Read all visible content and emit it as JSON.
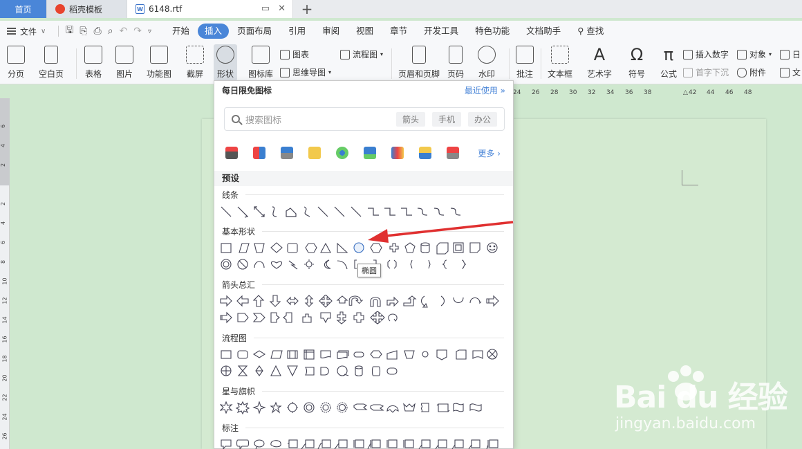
{
  "tabs": {
    "home": "首页",
    "template": "稻壳模板",
    "doc": "6148.rtf"
  },
  "menubar": {
    "file": "文件",
    "items": [
      "开始",
      "插入",
      "页面布局",
      "引用",
      "审阅",
      "视图",
      "章节",
      "开发工具",
      "特色功能",
      "文档助手",
      "查找"
    ],
    "active_index": 1
  },
  "ribbon": {
    "page_break": "分页",
    "blank_page": "空白页",
    "table": "表格",
    "picture": "图片",
    "function_chart": "功能图",
    "screenshot": "截屏",
    "shape": "形状",
    "icon_library": "图标库",
    "chart": "图表",
    "flowchart": "流程图",
    "mindmap": "思维导图",
    "header_footer": "页眉和页脚",
    "page_number": "页码",
    "watermark": "水印",
    "comment": "批注",
    "textbox": "文本框",
    "wordart": "艺术字",
    "symbol": "符号",
    "formula": "公式",
    "insert_number": "插入数字",
    "drop_cap": "首字下沉",
    "object": "对象",
    "attachment": "附件",
    "date_partial": "日",
    "doc_partial": "文"
  },
  "ruler": {
    "top": [
      "24",
      "26",
      "28",
      "30",
      "32",
      "34",
      "36",
      "38",
      "42",
      "44",
      "46",
      "48"
    ],
    "left": [
      "6",
      "4",
      "2",
      "2",
      "4",
      "6",
      "8",
      "10",
      "12",
      "14",
      "16",
      "18",
      "20",
      "22",
      "24",
      "26"
    ]
  },
  "panel": {
    "title": "每日限免图标",
    "recent": "最近使用",
    "search_placeholder": "搜索图标",
    "chips": [
      "箭头",
      "手机",
      "办公"
    ],
    "more": "更多",
    "preset": "预设",
    "categories": {
      "lines": "线条",
      "basic": "基本形状",
      "arrows": "箭头总汇",
      "flow": "流程图",
      "stars": "星与旗帜",
      "callouts": "标注"
    },
    "tooltip": "椭圆"
  },
  "colors": {
    "accent": "#4a86d8",
    "arrow": "#e03030",
    "doc_bg": "#cfe8cf"
  },
  "watermark": {
    "brand": "Bai du 经验",
    "url": "jingyan.baidu.com"
  }
}
